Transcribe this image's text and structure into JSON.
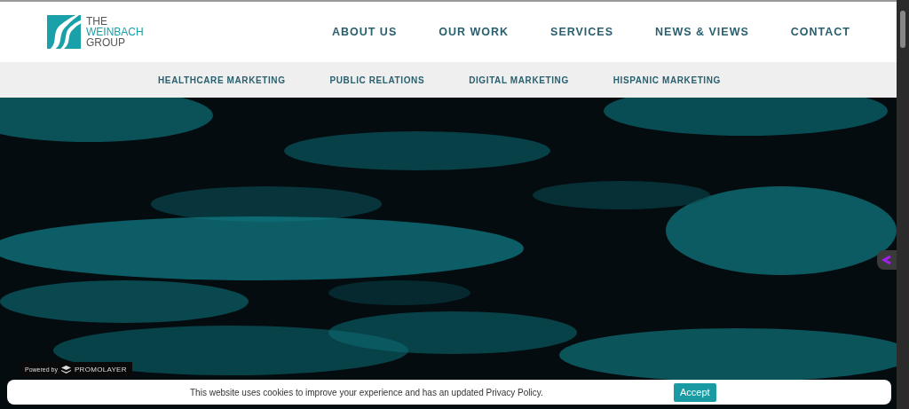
{
  "logo": {
    "lines": [
      "THE",
      "WEINBACH",
      "GROUP"
    ]
  },
  "nav": [
    {
      "label": "ABOUT US"
    },
    {
      "label": "OUR WORK"
    },
    {
      "label": "SERVICES"
    },
    {
      "label": "NEWS & VIEWS"
    },
    {
      "label": "CONTACT"
    }
  ],
  "subnav": [
    {
      "label": "HEALTHCARE MARKETING"
    },
    {
      "label": "PUBLIC RELATIONS"
    },
    {
      "label": "DIGITAL MARKETING"
    },
    {
      "label": "HISPANIC MARKETING"
    }
  ],
  "badge": {
    "prefix": "Powered by",
    "brand": "PROMOLAYER"
  },
  "cookie": {
    "text": "This website uses cookies to improve your experience and has an updated Privacy Policy.",
    "button": "Accept"
  }
}
